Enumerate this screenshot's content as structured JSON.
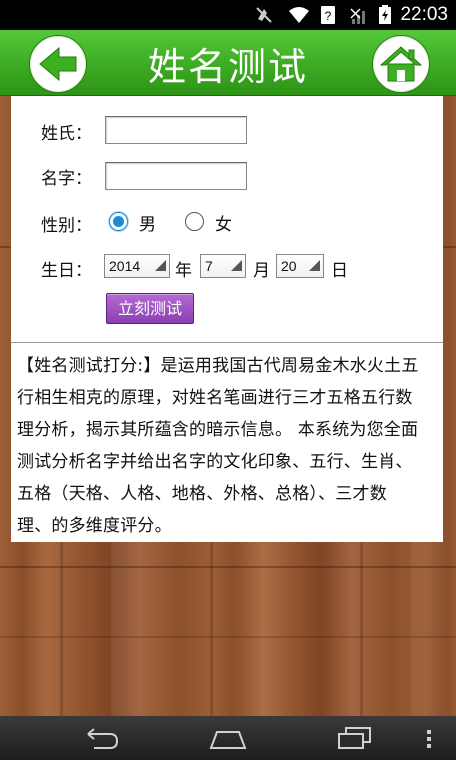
{
  "status_bar": {
    "time": "22:03",
    "icons": [
      "mute-icon",
      "wifi-icon",
      "sim-icon",
      "signal-icon",
      "battery-icon"
    ]
  },
  "header": {
    "title": "姓名测试",
    "back_icon": "back-arrow-icon",
    "home_icon": "home-icon"
  },
  "form": {
    "surname_label": "姓氏：",
    "surname_value": "",
    "name_label": "名字：",
    "name_value": "",
    "gender_label": "性别：",
    "gender_male": "男",
    "gender_female": "女",
    "gender_selected": "男",
    "birthday_label": "生日：",
    "year_value": "2014",
    "year_unit": "年",
    "month_value": "7",
    "month_unit": "月",
    "day_value": "20",
    "day_unit": "日",
    "submit_label": "立刻测试"
  },
  "description": {
    "lines": [
      "【姓名测试打分:】是运用我国古代周易金木水火土五",
      "行相生相克的原理，对姓名笔画进行三才五格五行数",
      "理分析，揭示其所蕴含的暗示信息。 本系统为您全面",
      "测试分析名字并给出名字的文化印象、五行、生肖、",
      "五格（天格、人格、地格、外格、总格）、三才数",
      "理、的多维度评分。"
    ]
  },
  "nav_bar": {
    "icons": [
      "back-nav-icon",
      "home-nav-icon",
      "recents-nav-icon",
      "menu-nav-icon"
    ]
  }
}
